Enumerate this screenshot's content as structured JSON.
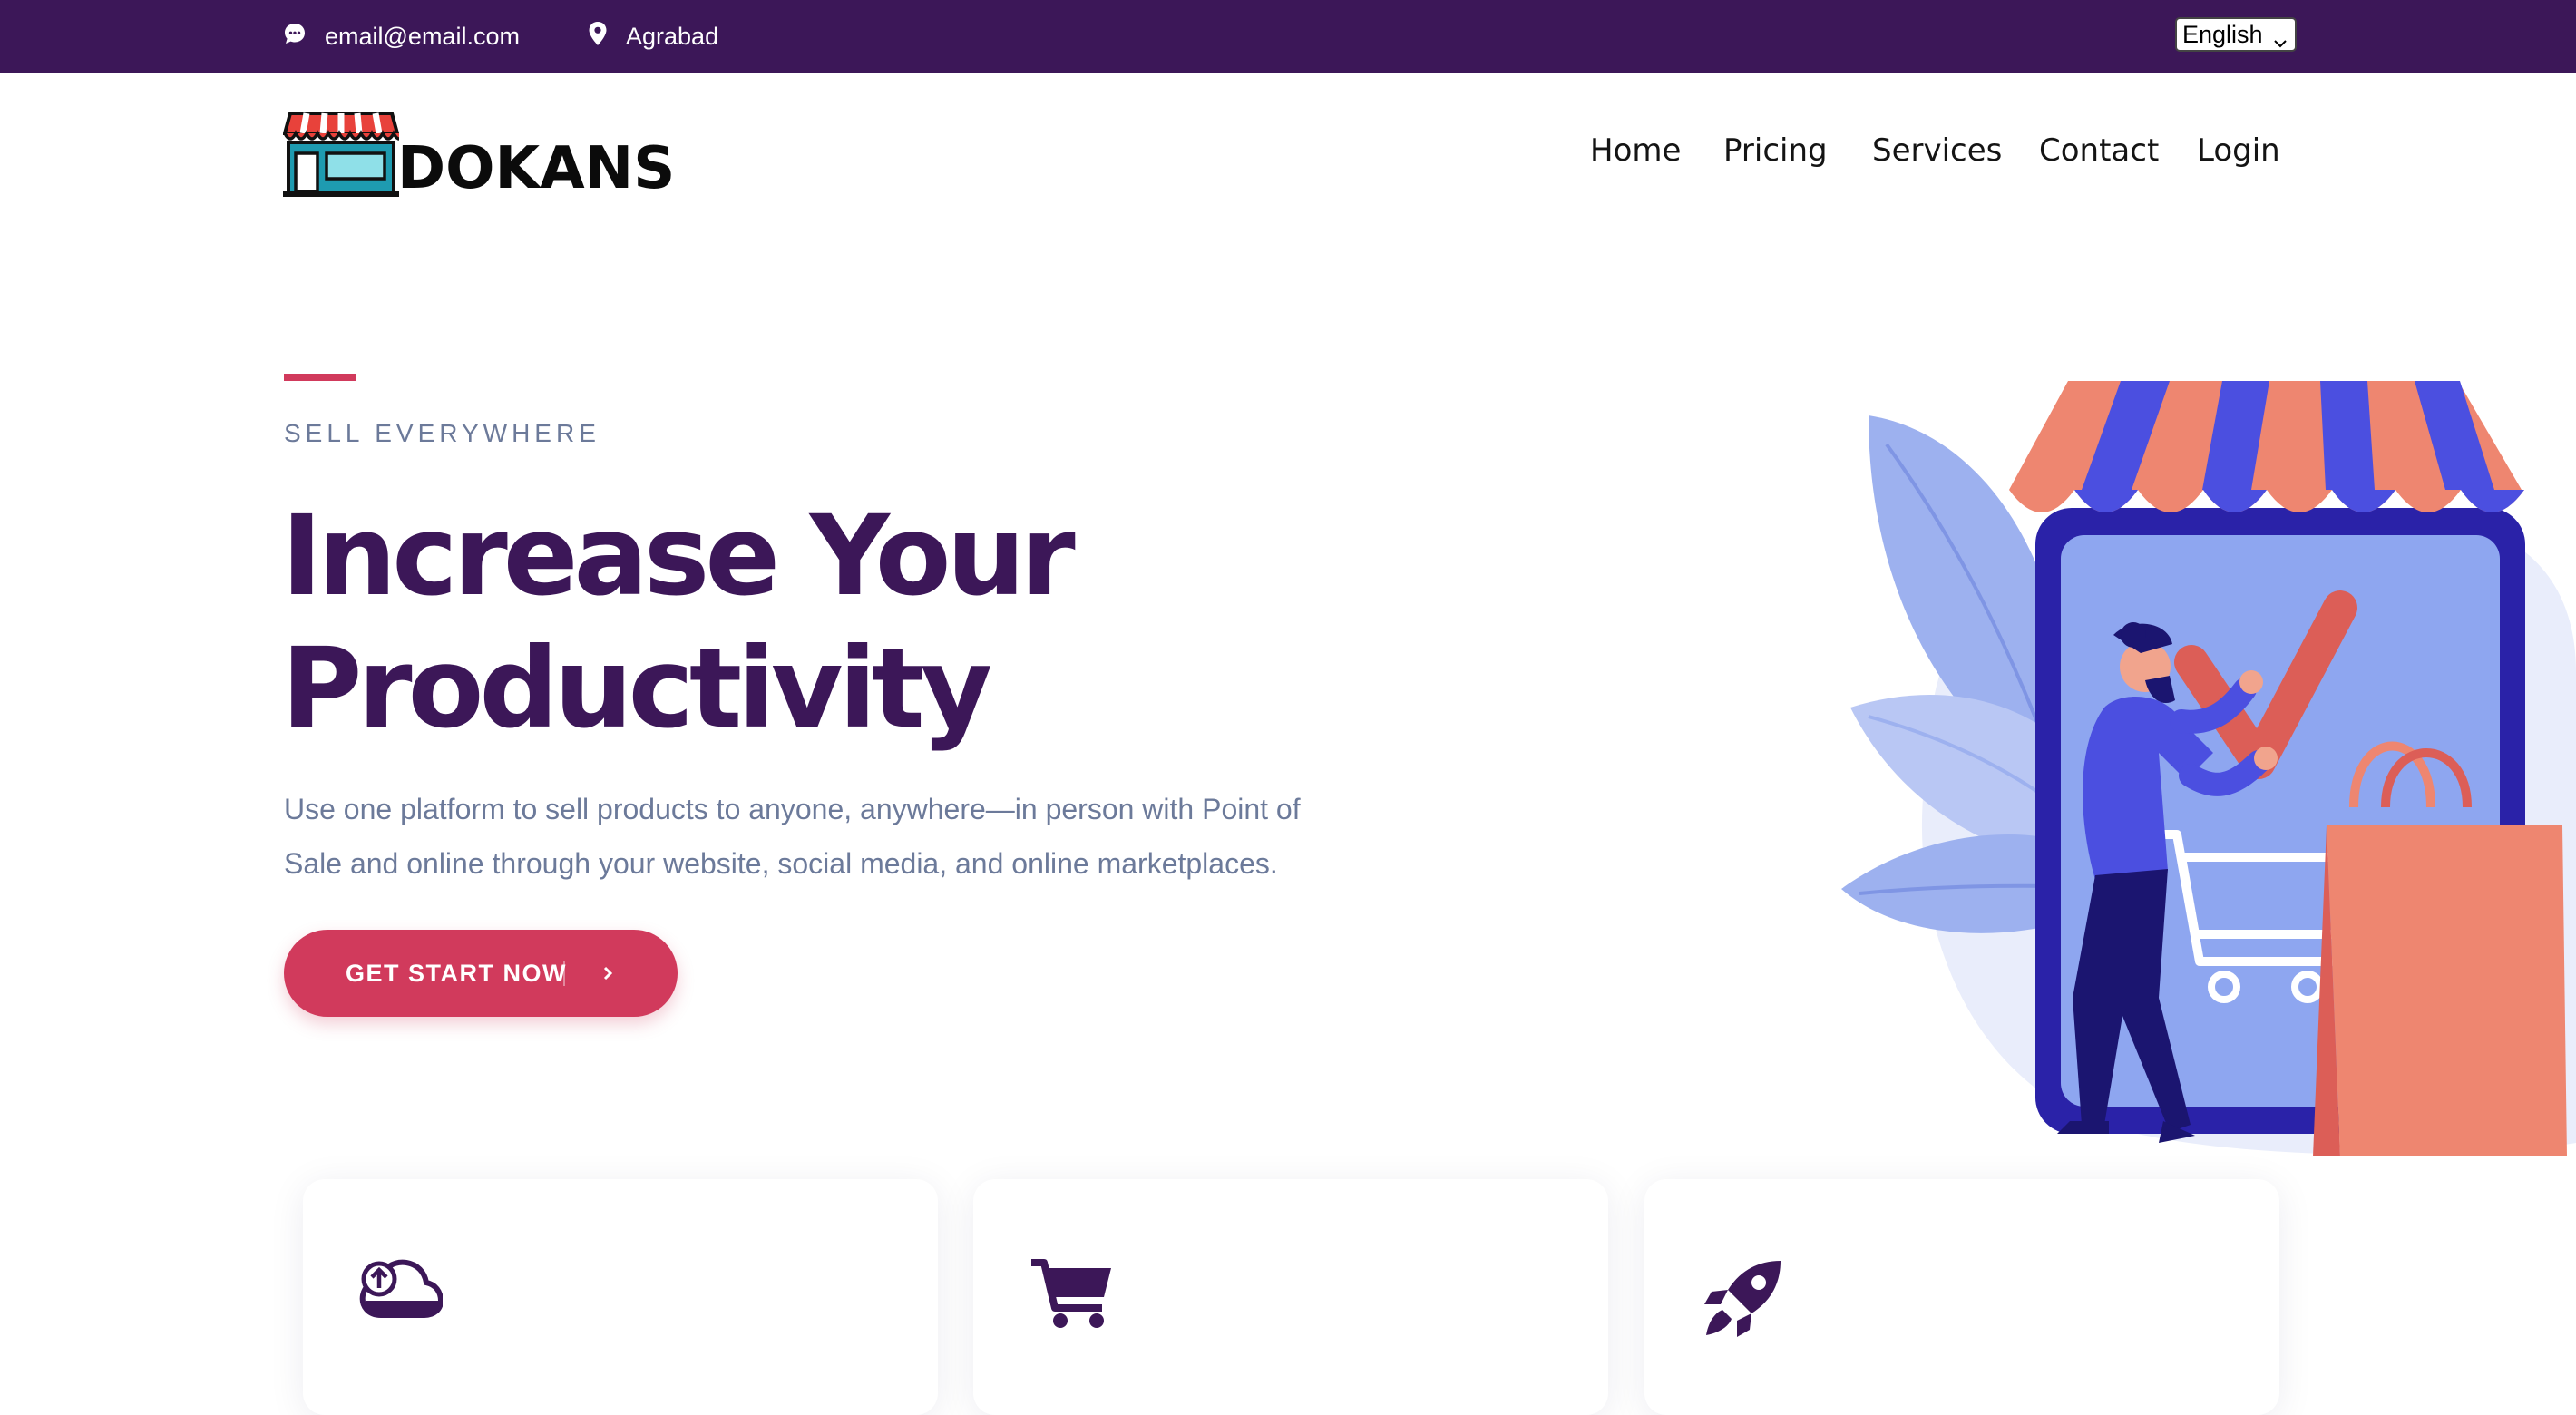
{
  "topbar": {
    "email": "email@email.com",
    "location": "Agrabad",
    "language_selected": "English"
  },
  "brand": {
    "logo_text": "DOKANS"
  },
  "nav": {
    "home": "Home",
    "pricing": "Pricing",
    "services": "Services",
    "contact": "Contact",
    "login": "Login"
  },
  "hero": {
    "eyebrow": "SELL EVERYWHERE",
    "headline_line1": "Increase Your",
    "headline_line2": "Productivity",
    "description": "Use one platform to sell products to anyone, anywhere—in person with Point of Sale and online through your website, social media, and online marketplaces.",
    "cta_label": "GET START NOW"
  },
  "feature_cards": {
    "card1_icon": "cloud-upload-icon",
    "card2_icon": "cart-icon",
    "card3_icon": "rocket-icon"
  },
  "colors": {
    "topbar_bg": "#3c1758",
    "heading": "#3c1758",
    "accent": "#d13a5c",
    "muted_text": "#6c7a9a",
    "illustration_blue": "#8ea6f0",
    "illustration_dark_blue": "#2a22a8",
    "illustration_coral": "#ee8670"
  }
}
